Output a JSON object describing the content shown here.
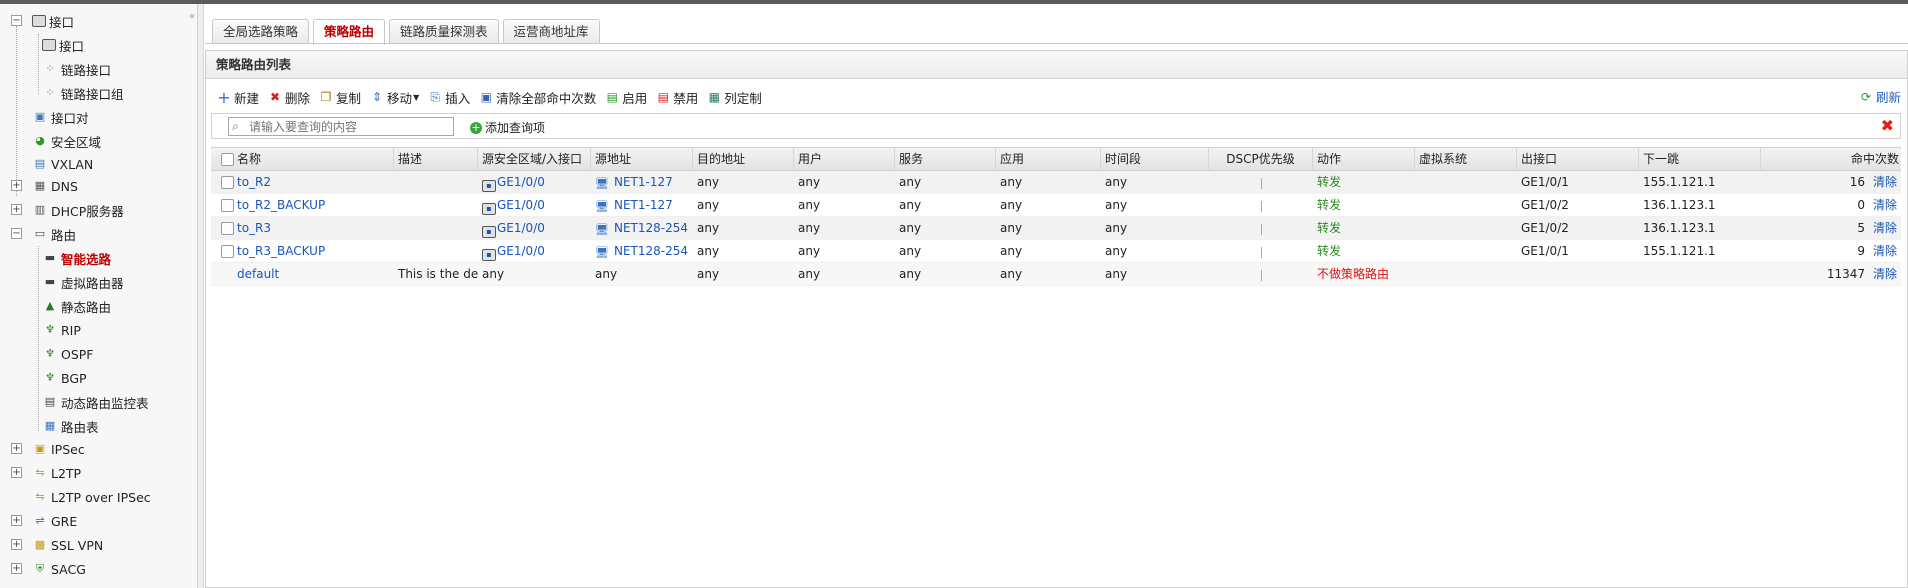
{
  "sidebar": {
    "items": [
      {
        "label": "接口",
        "icon": "interface-folder-icon",
        "toggle": "minus"
      },
      {
        "label": "接口",
        "icon": "interface-icon"
      },
      {
        "label": "链路接口",
        "icon": "link-interface-icon"
      },
      {
        "label": "链路接口组",
        "icon": "link-interface-group-icon"
      },
      {
        "label": "接口对",
        "icon": "interface-pair-icon"
      },
      {
        "label": "安全区域",
        "icon": "security-zone-icon"
      },
      {
        "label": "VXLAN",
        "icon": "vxlan-icon"
      },
      {
        "label": "DNS",
        "icon": "dns-icon",
        "toggle": "plus"
      },
      {
        "label": "DHCP服务器",
        "icon": "dhcp-server-icon",
        "toggle": "plus"
      },
      {
        "label": "路由",
        "icon": "route-folder-icon",
        "toggle": "minus"
      },
      {
        "label": "智能选路",
        "icon": "smart-routing-icon",
        "active": true
      },
      {
        "label": "虚拟路由器",
        "icon": "virtual-router-icon"
      },
      {
        "label": "静态路由",
        "icon": "static-route-icon"
      },
      {
        "label": "RIP",
        "icon": "rip-icon"
      },
      {
        "label": "OSPF",
        "icon": "ospf-icon"
      },
      {
        "label": "BGP",
        "icon": "bgp-icon"
      },
      {
        "label": "动态路由监控表",
        "icon": "dynamic-route-monitor-icon"
      },
      {
        "label": "路由表",
        "icon": "route-table-icon"
      },
      {
        "label": "IPSec",
        "icon": "ipsec-icon",
        "toggle": "plus"
      },
      {
        "label": "L2TP",
        "icon": "l2tp-icon",
        "toggle": "plus"
      },
      {
        "label": "L2TP over IPSec",
        "icon": "l2tp-over-ipsec-icon"
      },
      {
        "label": "GRE",
        "icon": "gre-icon",
        "toggle": "plus"
      },
      {
        "label": "SSL VPN",
        "icon": "ssl-vpn-icon",
        "toggle": "plus"
      },
      {
        "label": "SACG",
        "icon": "sacg-icon",
        "toggle": "plus"
      }
    ]
  },
  "tabs": [
    {
      "label": "全局选路策略"
    },
    {
      "label": "策略路由",
      "active": true
    },
    {
      "label": "链路质量探测表"
    },
    {
      "label": "运营商地址库"
    }
  ],
  "panel": {
    "title": "策略路由列表"
  },
  "toolbar": {
    "new": "新建",
    "delete": "删除",
    "copy": "复制",
    "move": "移动",
    "insert": "插入",
    "clear_hits": "清除全部命中次数",
    "enable": "启用",
    "disable": "禁用",
    "columns": "列定制",
    "refresh": "刷新"
  },
  "search": {
    "placeholder": "请输入要查询的内容",
    "add_query": "添加查询项"
  },
  "table": {
    "columns": [
      "名称",
      "描述",
      "源安全区域/入接口",
      "源地址",
      "目的地址",
      "用户",
      "服务",
      "应用",
      "时间段",
      "DSCP优先级",
      "动作",
      "虚拟系统",
      "出接口",
      "下一跳",
      "命中次数"
    ],
    "rows": [
      {
        "name": "to_R2",
        "desc": "",
        "src_if": "GE1/0/0",
        "src_addr": "NET1-127",
        "dst": "any",
        "user": "any",
        "service": "any",
        "app": "any",
        "time": "any",
        "action": "转发",
        "vsys": "",
        "out_if": "GE1/0/1",
        "next_hop": "155.1.121.1",
        "hits": "16",
        "clear": "清除"
      },
      {
        "name": "to_R2_BACKUP",
        "desc": "",
        "src_if": "GE1/0/0",
        "src_addr": "NET1-127",
        "dst": "any",
        "user": "any",
        "service": "any",
        "app": "any",
        "time": "any",
        "action": "转发",
        "vsys": "",
        "out_if": "GE1/0/2",
        "next_hop": "136.1.123.1",
        "hits": "0",
        "clear": "清除"
      },
      {
        "name": "to_R3",
        "desc": "",
        "src_if": "GE1/0/0",
        "src_addr": "NET128-254",
        "dst": "any",
        "user": "any",
        "service": "any",
        "app": "any",
        "time": "any",
        "action": "转发",
        "vsys": "",
        "out_if": "GE1/0/2",
        "next_hop": "136.1.123.1",
        "hits": "5",
        "clear": "清除"
      },
      {
        "name": "to_R3_BACKUP",
        "desc": "",
        "src_if": "GE1/0/0",
        "src_addr": "NET128-254",
        "dst": "any",
        "user": "any",
        "service": "any",
        "app": "any",
        "time": "any",
        "action": "转发",
        "vsys": "",
        "out_if": "GE1/0/1",
        "next_hop": "155.1.121.1",
        "hits": "9",
        "clear": "清除"
      },
      {
        "name": "default",
        "desc": "This is the def…",
        "src_if": "any",
        "src_addr": "any",
        "dst": "any",
        "user": "any",
        "service": "any",
        "app": "any",
        "time": "any",
        "action": "不做策略路由",
        "vsys": "",
        "out_if": "",
        "next_hop": "",
        "hits": "11347",
        "clear": "清除"
      }
    ]
  },
  "colors": {
    "active_red": "#c00000",
    "link_blue": "#1a55b8",
    "forward_green": "#2f8a22"
  }
}
